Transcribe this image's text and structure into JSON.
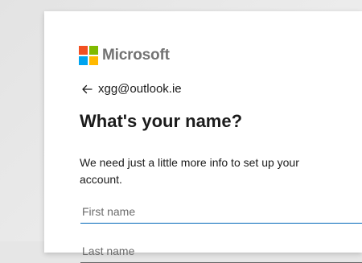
{
  "brand": {
    "name": "Microsoft",
    "colors": {
      "red": "#f25022",
      "green": "#7fba00",
      "blue": "#00a4ef",
      "yellow": "#ffb900"
    }
  },
  "identity": {
    "back_icon": "arrow-left-icon",
    "email": "xgg@outlook.ie"
  },
  "page": {
    "title": "What's your name?",
    "description": "We need just a little more info to set up your account."
  },
  "form": {
    "first_name": {
      "value": "",
      "placeholder": "First name"
    },
    "last_name": {
      "value": "",
      "placeholder": "Last name"
    }
  },
  "theme": {
    "accent": "#0067b8",
    "text": "#1b1b1b"
  }
}
